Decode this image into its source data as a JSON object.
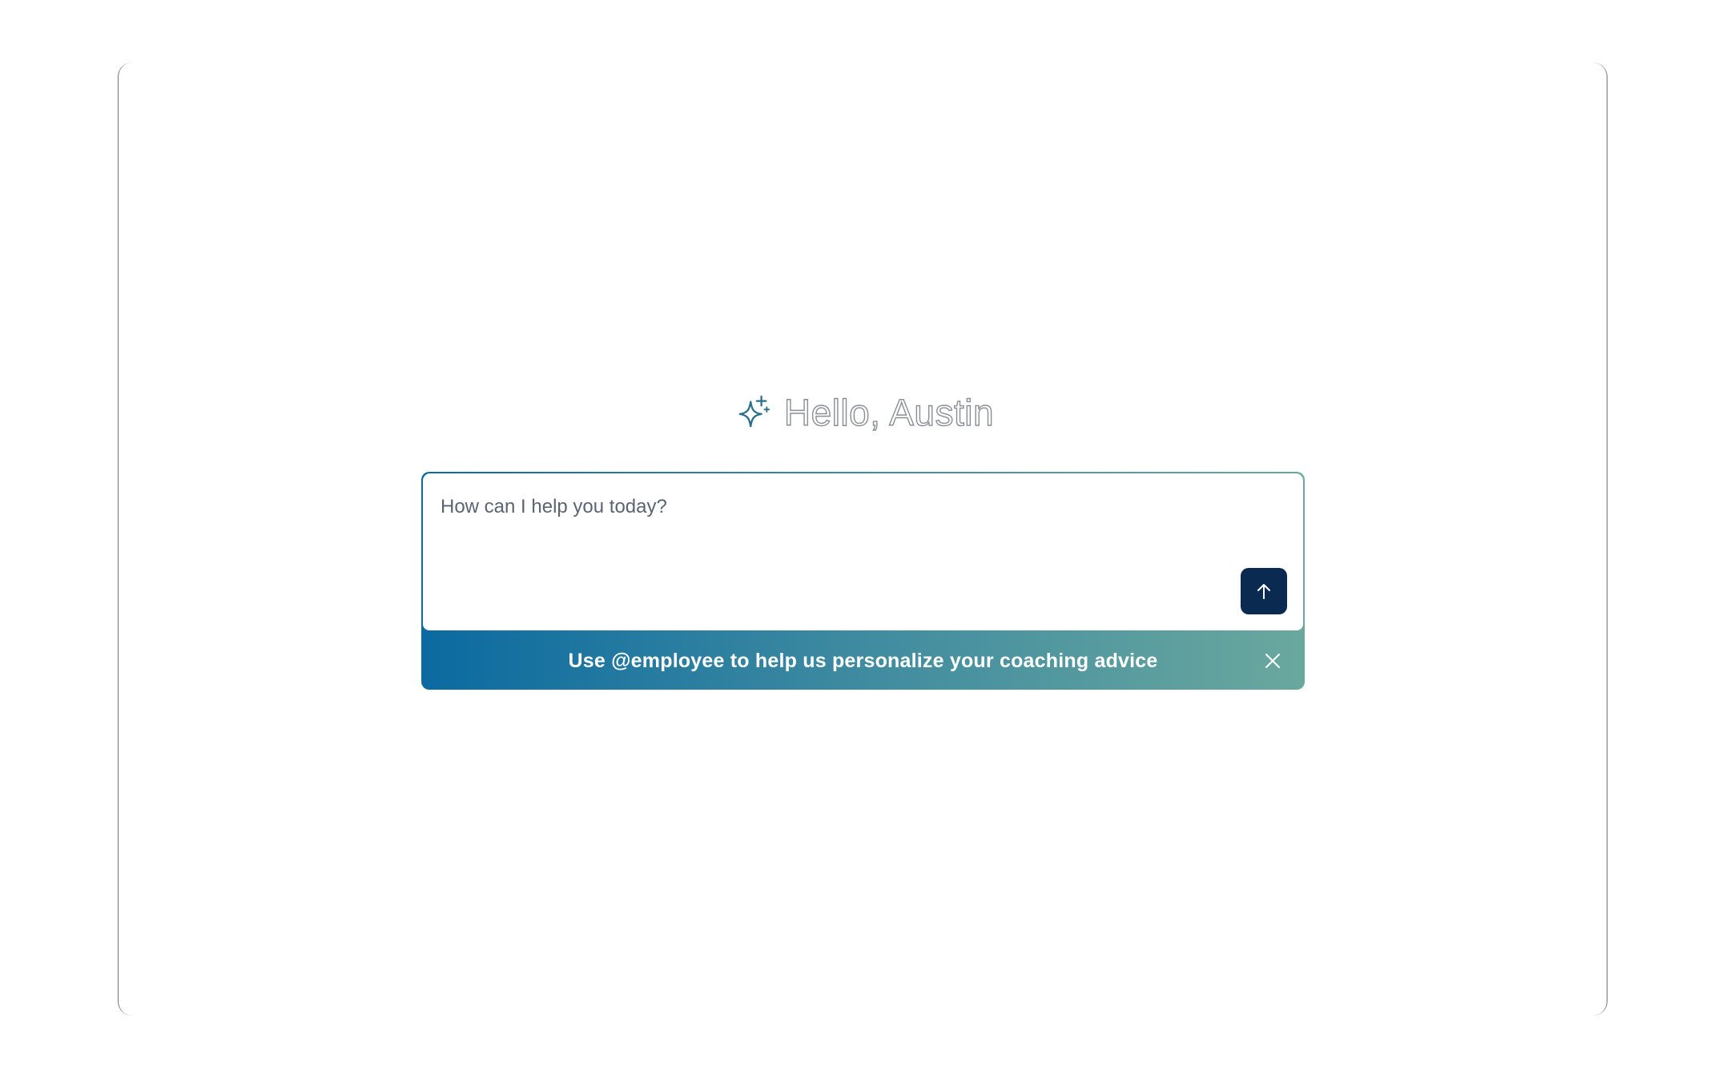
{
  "greeting": {
    "text": "Hello, Austin",
    "icon": "sparkle-icon",
    "icon_color": "#2b6f8c"
  },
  "composer": {
    "placeholder": "How can I help you today?",
    "value": "",
    "send_icon": "arrow-up-icon",
    "send_button_color": "#0a2a52"
  },
  "banner": {
    "text": "Use @employee to help us personalize your coaching advice",
    "close_icon": "close-icon",
    "gradient": [
      "#0b6aa0",
      "#6aa89e"
    ]
  }
}
